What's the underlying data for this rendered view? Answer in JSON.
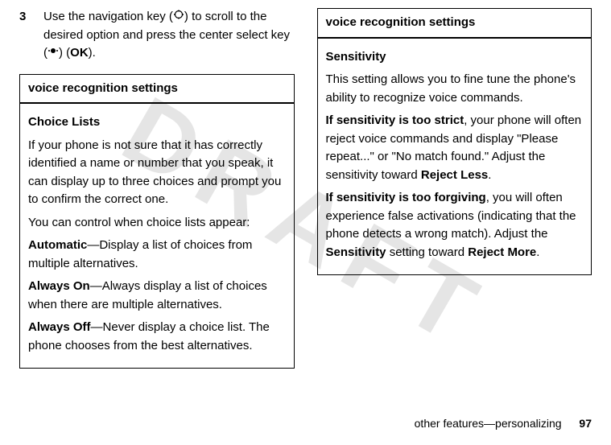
{
  "watermark": "DRAFT",
  "left": {
    "step_num": "3",
    "step_text_a": "Use the navigation key (",
    "step_text_b": ") to scroll to the desired option and press the center select key (",
    "step_text_c": ") (",
    "ok": "OK",
    "step_text_d": ").",
    "box_header": "voice recognition settings",
    "subheading": "Choice Lists",
    "p1": "If your phone is not sure that it has correctly identified a name or number that you speak, it can display up to three choices and prompt you to confirm the correct one.",
    "p2": "You can control when choice lists appear:",
    "opt1_label": "Automatic",
    "opt1_text": "—Display a list of choices from multiple alternatives.",
    "opt2_label": "Always On",
    "opt2_text": "—Always display a list of choices when there are multiple alternatives.",
    "opt3_label": "Always Off",
    "opt3_text": "—Never display a choice list. The phone chooses from the best alternatives."
  },
  "right": {
    "box_header": "voice recognition settings",
    "subheading": "Sensitivity",
    "p1": "This setting allows you to fine tune the phone's ability to recognize voice commands.",
    "p2a": "If sensitivity is too strict",
    "p2b": ", your phone will often reject voice commands and display \"Please repeat...\" or \"No match found.\" Adjust the sensitivity toward ",
    "p2c": "Reject Less",
    "p2d": ".",
    "p3a": "If sensitivity is too forgiving",
    "p3b": ", you will often experience false activations (indicating that the phone detects a wrong match). Adjust the ",
    "p3c": "Sensitivity",
    "p3d": " setting toward ",
    "p3e": "Reject More",
    "p3f": "."
  },
  "footer": {
    "text": "other features—personalizing",
    "page": "97"
  }
}
